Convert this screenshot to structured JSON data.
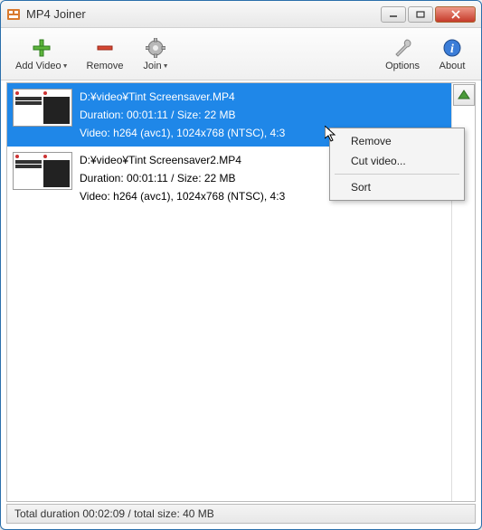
{
  "window": {
    "title": "MP4 Joiner"
  },
  "toolbar": {
    "add_video": "Add Video",
    "remove": "Remove",
    "join": "Join",
    "options": "Options",
    "about": "About"
  },
  "items": [
    {
      "path": "D:¥video¥Tint Screensaver.MP4",
      "meta": "Duration: 00:01:11 / Size: 22 MB",
      "video": "Video: h264 (avc1), 1024x768 (NTSC), 4:3",
      "selected": true
    },
    {
      "path": "D:¥video¥Tint Screensaver2.MP4",
      "meta": "Duration: 00:01:11 / Size: 22 MB",
      "video": "Video: h264 (avc1), 1024x768 (NTSC), 4:3",
      "selected": false
    }
  ],
  "context_menu": {
    "remove": "Remove",
    "cut": "Cut video...",
    "sort": "Sort"
  },
  "status": "Total duration 00:02:09 / total size: 40 MB"
}
